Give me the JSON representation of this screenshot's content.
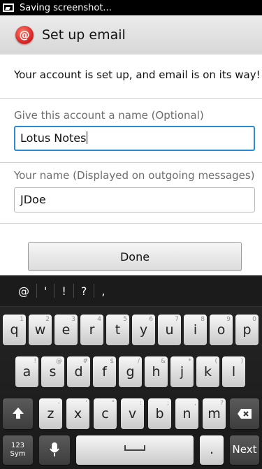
{
  "status": {
    "text": "Saving screenshot..."
  },
  "header": {
    "icon_label": "@",
    "title": "Set up email"
  },
  "content": {
    "message": "Your account is set up, and email is on its way!",
    "account_name_label": "Give this account a name (Optional)",
    "account_name_value": "Lotus Notes",
    "your_name_label": "Your name (Displayed on outgoing messages)",
    "your_name_value": "JDoe",
    "done_label": "Done"
  },
  "keyboard": {
    "suggestions": [
      "@",
      "'",
      "!",
      "?",
      ","
    ],
    "row1": [
      {
        "k": "q",
        "h": "1"
      },
      {
        "k": "w",
        "h": "2"
      },
      {
        "k": "e",
        "h": "3"
      },
      {
        "k": "r",
        "h": "4"
      },
      {
        "k": "t",
        "h": "5"
      },
      {
        "k": "y",
        "h": "6"
      },
      {
        "k": "u",
        "h": "7"
      },
      {
        "k": "i",
        "h": "8"
      },
      {
        "k": "o",
        "h": "9"
      },
      {
        "k": "p",
        "h": "0"
      }
    ],
    "row2": [
      {
        "k": "a",
        "h": "!"
      },
      {
        "k": "s",
        "h": "@"
      },
      {
        "k": "d",
        "h": "#"
      },
      {
        "k": "f",
        "h": "$"
      },
      {
        "k": "g",
        "h": "/"
      },
      {
        "k": "h",
        "h": "&"
      },
      {
        "k": "j",
        "h": "*"
      },
      {
        "k": "k",
        "h": "("
      },
      {
        "k": "l",
        "h": ")"
      }
    ],
    "row3": [
      {
        "k": "z",
        "h": "-"
      },
      {
        "k": "x",
        "h": "'"
      },
      {
        "k": "c",
        "h": "\""
      },
      {
        "k": "v",
        "h": ":"
      },
      {
        "k": "b",
        "h": ";"
      },
      {
        "k": "n",
        "h": ","
      },
      {
        "k": "m",
        "h": "?"
      }
    ],
    "sym_label_line1": "123",
    "sym_label_line2": "Sym",
    "period_label": ".",
    "next_label": "Next"
  }
}
